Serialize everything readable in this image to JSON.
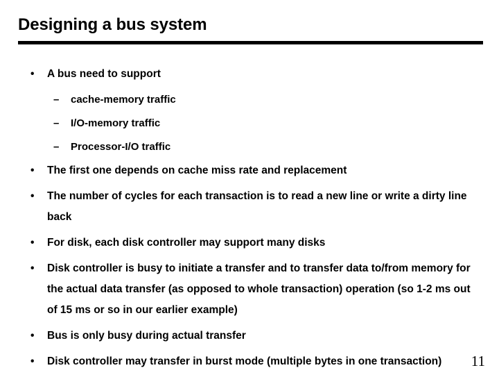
{
  "slide": {
    "title": "Designing a bus system",
    "page_number": "11",
    "background_color": "#ffffff",
    "text_color": "#000000",
    "rule_color": "#000000",
    "bullet_marker_level1": "•",
    "bullet_marker_level2": "–",
    "bullets": [
      {
        "level": 1,
        "text": "A bus need to support"
      },
      {
        "level": 2,
        "text": "cache-memory traffic"
      },
      {
        "level": 2,
        "text": "I/O-memory traffic"
      },
      {
        "level": 2,
        "text": "Processor-I/O traffic"
      },
      {
        "level": 1,
        "text": "The first one depends on cache miss rate and replacement"
      },
      {
        "level": 1,
        "text": "The number of cycles for each transaction is to read a new line or write a dirty line back"
      },
      {
        "level": 1,
        "text": "For disk, each disk controller may support many disks"
      },
      {
        "level": 1,
        "text": "Disk controller is busy to initiate a transfer and to transfer data to/from memory for the actual data transfer (as opposed to whole transaction) operation (so 1-2 ms out of 15 ms or so in our earlier example)"
      },
      {
        "level": 1,
        "text": "Bus is only busy during actual transfer"
      },
      {
        "level": 1,
        "text": "Disk controller may transfer in burst mode (multiple bytes in one transaction)"
      }
    ]
  }
}
